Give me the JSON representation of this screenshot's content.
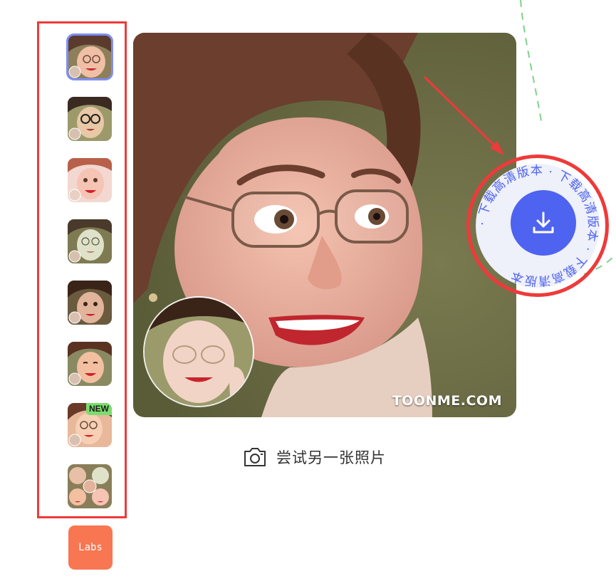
{
  "sidebar": {
    "styles": [
      {
        "name": "style-1",
        "selected": true,
        "badge": ""
      },
      {
        "name": "style-2",
        "selected": false,
        "badge": ""
      },
      {
        "name": "style-3",
        "selected": false,
        "badge": ""
      },
      {
        "name": "style-4",
        "selected": false,
        "badge": ""
      },
      {
        "name": "style-5",
        "selected": false,
        "badge": ""
      },
      {
        "name": "style-6",
        "selected": false,
        "badge": ""
      },
      {
        "name": "style-7",
        "selected": false,
        "badge": "NEW"
      },
      {
        "name": "style-8",
        "selected": false,
        "badge": ""
      }
    ],
    "labs_label": "Labs"
  },
  "main": {
    "watermark": "TOONME.COM"
  },
  "actions": {
    "try_another_label": "尝试另一张照片",
    "download_ring_text": "· 下载高清版本 · 下载高清版本 · 下载高清版本",
    "download_icon": "download-icon",
    "camera_icon": "camera-icon"
  },
  "colors": {
    "annotation_red": "#ee3a3a",
    "download_blue": "#4e63f0",
    "selected_outline": "#7f8ff3",
    "labs_orange": "#f87652",
    "new_badge_green": "#7bdc6f"
  }
}
